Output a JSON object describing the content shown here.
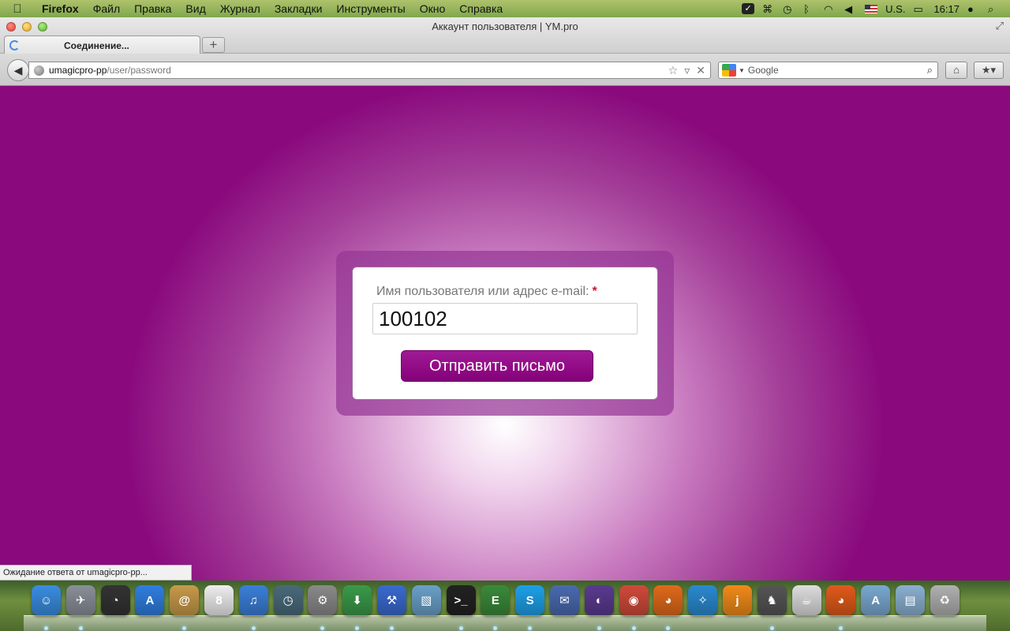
{
  "menubar": {
    "apple_icon": "apple-icon",
    "items": [
      "Firefox",
      "Файл",
      "Правка",
      "Вид",
      "Журнал",
      "Закладки",
      "Инструменты",
      "Окно",
      "Справка"
    ],
    "input_source": "U.S.",
    "clock": "16:17"
  },
  "window": {
    "title": "Аккаунт пользователя | YM.pro",
    "tab_label": "Соединение...",
    "new_tab_label": "+"
  },
  "navbar": {
    "url_host": "umagicpro-pp",
    "url_path": "/user/password",
    "search_placeholder": "Google"
  },
  "form": {
    "field_label": "Имя пользователя или адрес e-mail:",
    "required_mark": "*",
    "username_value": "100102",
    "submit_label": "Отправить письмо"
  },
  "status": {
    "text": "Ожидание ответа от umagicpro-pp..."
  },
  "colors": {
    "brand_purple": "#8a0a7e",
    "button": "#940088",
    "required": "#d1132a"
  },
  "dock": {
    "icons": [
      {
        "name": "finder-icon",
        "glyph": "☺",
        "color": "#3a8de0"
      },
      {
        "name": "launchpad-icon",
        "glyph": "✈",
        "color": "#8a8f99"
      },
      {
        "name": "dashboard-icon",
        "glyph": "◔",
        "color": "#333333"
      },
      {
        "name": "app-store-icon",
        "glyph": "A",
        "color": "#2f7ee0"
      },
      {
        "name": "address-book-icon",
        "glyph": "@",
        "color": "#c79a4a"
      },
      {
        "name": "calendar-icon",
        "glyph": "8",
        "color": "#eeeeee"
      },
      {
        "name": "itunes-icon",
        "glyph": "♫",
        "color": "#3b7fd8"
      },
      {
        "name": "time-machine-icon",
        "glyph": "◷",
        "color": "#4a6a7a"
      },
      {
        "name": "system-preferences-icon",
        "glyph": "⚙",
        "color": "#8a8a8a"
      },
      {
        "name": "network-download-icon",
        "glyph": "⬇",
        "color": "#3a9a4a"
      },
      {
        "name": "xcode-icon",
        "glyph": "⚒",
        "color": "#3a6ad0"
      },
      {
        "name": "preview-icon",
        "glyph": "▧",
        "color": "#6aa0c8"
      },
      {
        "name": "terminal-icon",
        "glyph": ">_",
        "color": "#222222"
      },
      {
        "name": "evernote-icon",
        "glyph": "E",
        "color": "#3a8a3a"
      },
      {
        "name": "skype-icon",
        "glyph": "S",
        "color": "#1ea0e8"
      },
      {
        "name": "mail-icon",
        "glyph": "✉",
        "color": "#4a6ab0"
      },
      {
        "name": "eclipse-icon",
        "glyph": "◐",
        "color": "#5a3a90"
      },
      {
        "name": "chrome-icon",
        "glyph": "◉",
        "color": "#d04a3a"
      },
      {
        "name": "firefox-icon",
        "glyph": "◕",
        "color": "#e06a1a"
      },
      {
        "name": "safari-icon",
        "glyph": "✧",
        "color": "#2a8ad0"
      },
      {
        "name": "joinme-icon",
        "glyph": "j",
        "color": "#f08a1a"
      },
      {
        "name": "github-icon",
        "glyph": "♞",
        "color": "#555555"
      },
      {
        "name": "coffee-icon",
        "glyph": "☕",
        "color": "#dddddd"
      },
      {
        "name": "firefox-2-icon",
        "glyph": "◕",
        "color": "#e05a1a"
      },
      {
        "name": "applications-folder-icon",
        "glyph": "A",
        "color": "#7aa8d0"
      },
      {
        "name": "documents-folder-icon",
        "glyph": "▤",
        "color": "#8ab0d0"
      },
      {
        "name": "trash-icon",
        "glyph": "♻",
        "color": "#b0b0b0"
      }
    ]
  }
}
